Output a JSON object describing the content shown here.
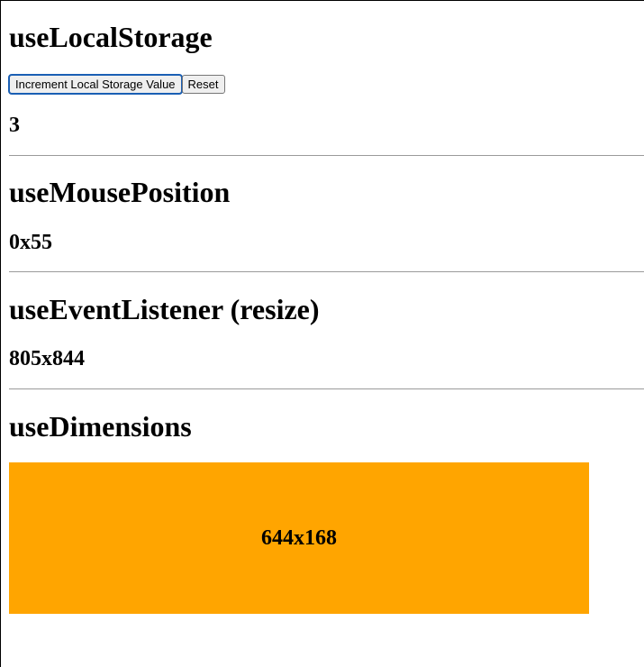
{
  "local_storage": {
    "title": "useLocalStorage",
    "increment_label": "Increment Local Storage Value",
    "reset_label": "Reset",
    "value": "3"
  },
  "mouse_position": {
    "title": "useMousePosition",
    "value": "0x55"
  },
  "event_listener": {
    "title": "useEventListener (resize)",
    "value": "805x844"
  },
  "dimensions": {
    "title": "useDimensions",
    "value": "644x168",
    "box_color": "#ffa500"
  }
}
